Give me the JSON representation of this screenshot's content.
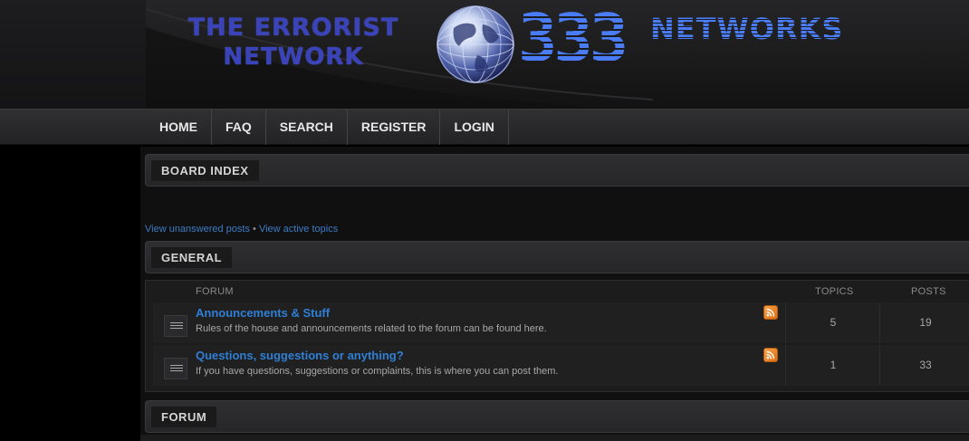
{
  "header": {
    "logo_line1": "THE ERRORIST",
    "logo_line2": "NETWORK",
    "logo_333": "333",
    "logo_networks": "NETWORKS",
    "globe": "globe-icon"
  },
  "nav": {
    "items": [
      {
        "label": "HOME"
      },
      {
        "label": "FAQ"
      },
      {
        "label": "SEARCH"
      },
      {
        "label": "REGISTER"
      },
      {
        "label": "LOGIN"
      }
    ]
  },
  "board_index": {
    "label": "BOARD INDEX"
  },
  "links": {
    "unanswered": "View unanswered posts",
    "separator": "•",
    "active": "View active topics"
  },
  "general": {
    "label": "GENERAL",
    "columns": {
      "forum": "FORUM",
      "topics": "TOPICS",
      "posts": "POSTS"
    },
    "forums": [
      {
        "title": "Announcements & Stuff",
        "description": "Rules of the house and announcements related to the forum can be found here.",
        "topics": "5",
        "posts": "19",
        "icon": "forum-read-icon",
        "feed_icon": "rss-icon"
      },
      {
        "title": "Questions, suggestions or anything?",
        "description": "If you have questions, suggestions or complaints, this is where you can post them.",
        "topics": "1",
        "posts": "33",
        "icon": "forum-read-icon",
        "feed_icon": "rss-icon"
      }
    ]
  },
  "forum_section": {
    "label": "FORUM"
  },
  "colors": {
    "link": "#2f7fd6",
    "background": "#000000",
    "logo_blue": "#4a7df5",
    "logo_navy": "#3a44b8"
  }
}
